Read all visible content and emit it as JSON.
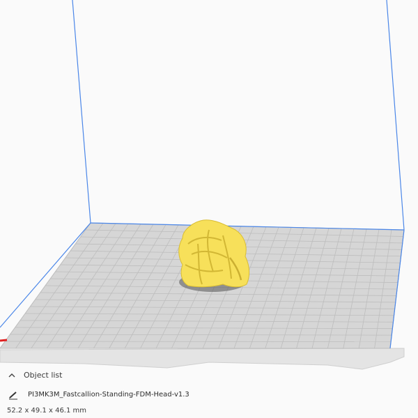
{
  "object_list": {
    "header_label": "Object list",
    "items": [
      {
        "name": "PI3MK3M_Fastcallion-Standing-FDM-Head-v1.3"
      }
    ],
    "selected_dimensions": "52.2 x 49.1 x 46.1 mm"
  },
  "colors": {
    "model": "#f7e05a",
    "model_shadow": "#c8ac2a",
    "build_volume_outline": "#4a86e8",
    "build_plate": "#d3d3d3",
    "plate_grid": "#bdbdbd",
    "x_axis_indicator": "#e02020"
  },
  "icons": {
    "collapse": "chevron-up-icon",
    "object": "pencil-icon"
  }
}
